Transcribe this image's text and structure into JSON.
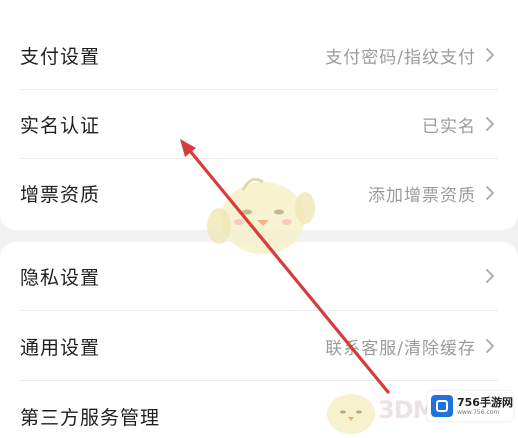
{
  "card1": {
    "rows": [
      {
        "title": "支付设置",
        "value": "支付密码/指纹支付"
      },
      {
        "title": "实名认证",
        "value": "已实名"
      },
      {
        "title": "增票资质",
        "value": "添加增票资质"
      }
    ]
  },
  "card2": {
    "rows": [
      {
        "title": "隐私设置",
        "value": ""
      },
      {
        "title": "通用设置",
        "value": "联系客服/清除缓存"
      },
      {
        "title": "第三方服务管理",
        "value": ""
      }
    ]
  },
  "watermark": {
    "logo_text": "3DM",
    "badge_main": "756手游网",
    "badge_sub": "www.756.com"
  },
  "colors": {
    "annotation_arrow": "#d93a3a",
    "badge_icon": "#1e74d8"
  }
}
